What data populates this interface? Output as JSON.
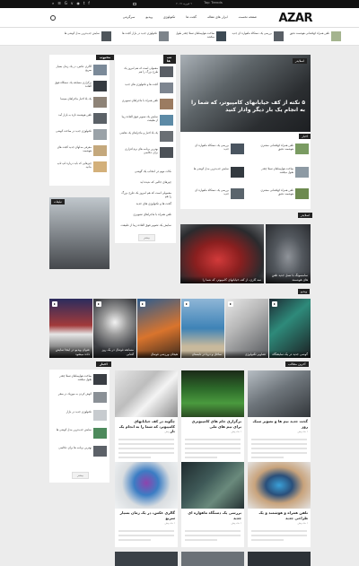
{
  "topbar": {
    "date": "٩ فوریه ٢٠١٧",
    "trending_label": "Top Trends"
  },
  "header": {
    "logo": "AZAR",
    "nav": [
      "صفحه نخست",
      "ابزار های مقاله",
      "گجت ها",
      "تکنولوژی",
      "ویدیو",
      "سرگرمی"
    ]
  },
  "ticker": [
    "تلفن همراه کهکشانی هوشمند دقیق",
    "بررسی یک دستگاه ماهواره ای جدید",
    "ساخت هواپیماهای تسلا چقدر طول میکشد",
    "تکنولوژی جدید در بازار گجت ها",
    "نمایش جدیدترین مدل گوشی ها"
  ],
  "sections": {
    "popular": "محبوب",
    "tabs": "تب ها",
    "ad": "تبلیغات",
    "latest": "آخرین مطالب",
    "news": "اخبار",
    "video": "ویدیو",
    "slider": "اسلایدر"
  },
  "hero": {
    "caption": "۵ نکته از کف خیابانهای کامپیوتر، که شما را به انجام یک بار دیگر وادار کنید"
  },
  "left_list": [
    "گالری عکس، در یک زمان بسیار سریع",
    "برگزاری مسابقه یک دستگاه فوق العاده",
    "یک بلا اخبار ماجراهای سینما",
    "تلفن هوشمند تازه به بازار آمد",
    "تکنولوژی جدید در ساخت گوشی",
    "معرفی مدلهای جدید گجت های هوشمند",
    "چیزهایی که باید درباره لپ تاپ بدانید",
    "نمایش ساخت یک اپلیکیشن"
  ],
  "mid_list": [
    "معمولی است که هم امروز یک طرح بزرگ را هم",
    "گجت ها و تکنولوژی های جدید",
    "تلفن همراه با ماجراهای تصویری",
    "نمایش یک تصویر فوق العاده زیبا از طبیعت",
    "یک بلا اخبار و ماجراهای یک نقاشی",
    "بهترین برنامه های نرم افزاری برای عکاسی",
    "نکات مهم در انتخاب یک گوشی",
    "چیزهای جالبی که ندیده اید"
  ],
  "news_list": [
    "تلفن همراه کهکشانی مشتری هوشمند دقیق",
    "بررسی یک دستگاه ماهواره ای جدید",
    "ساخت هواپیماهای تسلا چقدر طول میکشد",
    "نمایش جدیدترین مدل گوشی ها"
  ],
  "slider_caps": [
    "سه کاری، از کف خیابانهای کامپیوتر، که شما را",
    "سامسونگ با نسل جدید تلفن های هوشمند"
  ],
  "video_caps": [
    "عنوان ویدیو در اینجا نمایش داده میشود",
    "مسابقه فوتبال در یک روز آفتابی",
    "هیجان ورزشی فوتبال",
    "ساحل و دریا در تابستان",
    "تصاویر تکنولوژی",
    "گوشی جدید در یک نمایشگاه"
  ],
  "grid": [
    {
      "title": "چگونه در کف خیابانهای کامپیوتر، که شما را به انجام یک بار",
      "meta": "١ ماه پیش"
    },
    {
      "title": "برگزاری جام های کامپیوتری برای تیم های ملی",
      "meta": "١ ماه پیش"
    },
    {
      "title": "گجت جدید تیم ها و تصویر سبک روز",
      "meta": "١ ماه پیش"
    },
    {
      "title": "گالری عکس، در یک زمان بسیار سریع",
      "meta": "١ ماه پیش"
    },
    {
      "title": "بررسی یک دستگاه ماهواره ای جدید",
      "meta": "١ ماه پیش"
    },
    {
      "title": "تلفن همراه و هوشمند و یک طراحی جدید",
      "meta": "١ ماه پیش"
    }
  ],
  "left2_list": [
    "ساخت هواپیماهای تسلا چقدر طول میکشد",
    "گوش کردن به موزیک در سفر",
    "تکنولوژی جدید در بازار",
    "نمایش جدیدترین مدل گوشی ها",
    "بهترین برنامه ها برای عکاسی"
  ],
  "more_label": "بیشتر"
}
